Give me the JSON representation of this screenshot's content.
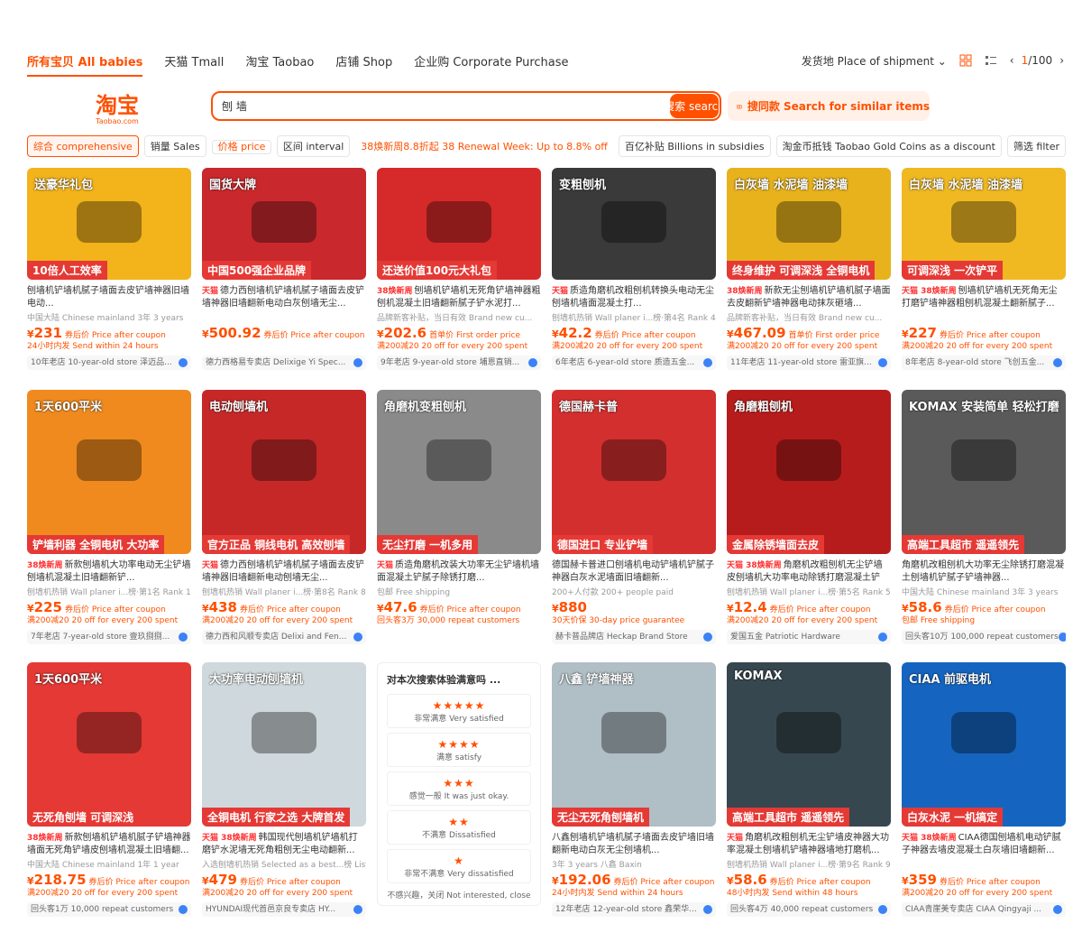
{
  "nav": {
    "tabs": [
      {
        "label": "所有宝贝  All babies",
        "active": true
      },
      {
        "label": "天猫  Tmall"
      },
      {
        "label": "淘宝  Taobao"
      },
      {
        "label": "店铺  Shop"
      },
      {
        "label": "企业购  Corporate Purchase"
      }
    ],
    "ship": "发货地  Place of shipment ⌄",
    "pager_cur": "1",
    "pager_total": "/100",
    "prev": "‹",
    "next": "›"
  },
  "logo": {
    "cn": "淘宝",
    "en": "Taobao.com"
  },
  "search": {
    "value": "刨 墙",
    "button": "搜索  search"
  },
  "similar": {
    "label": "搜同款  Search for similar items"
  },
  "filters": [
    {
      "label": "综合  comprehensive",
      "active": true
    },
    {
      "label": "销量  Sales"
    },
    {
      "label": "价格  price",
      "kind": "price"
    },
    {
      "label": "区间  interval",
      "kind": "interval"
    },
    {
      "label": "38焕新周8.8折起  38 Renewal Week: Up to 8.8% off",
      "kind": "promo"
    },
    {
      "label": "百亿补贴  Billions in subsidies"
    },
    {
      "label": "淘金币抵钱  Taobao Gold Coins as a discount"
    },
    {
      "label": "筛选  filter"
    }
  ],
  "products": [
    {
      "bg": "#f2b31b",
      "text": "送豪华礼包",
      "badge": "10倍人工效率",
      "tag": "",
      "title": "刨墙机铲墙机腻子墙面去皮铲墙神器旧墙电动...",
      "meta": "中国大陆  Chinese mainland  3年  3 years",
      "price": "231",
      "plabel": "券后价  Price after coupon",
      "disc": "24小时内发  Send within 24 hours",
      "store": "10年老店  10-year-old store  泽迈品..."
    },
    {
      "bg": "#c9282d",
      "text": "国货大牌",
      "badge": "中国500强企业品牌",
      "tag": "天猫",
      "title": "德力西刨墙机铲墙机腻子墙面去皮铲墙神器旧墙翻新电动白灰刨墙无尘...",
      "meta": "",
      "price": "500.92",
      "plabel": "券后价  Price after coupon",
      "disc": "",
      "store": "德力西格易专卖店  Delixige Yi Spec..."
    },
    {
      "bg": "#d62a2a",
      "text": "",
      "badge": "还送价值100元大礼包",
      "tag": "38焕新周",
      "title": "刨墙机铲墙机无死角铲墙神器粗刨机混凝土旧墙翻新腻子铲水泥打...",
      "meta": "品牌新客补贴，当日有效  Brand new cu...",
      "price": "202.6",
      "plabel": "首单价  First order price",
      "disc": "满200减20  20 off for every 200 spent",
      "store": "9年老店  9-year-old store  埔恩直销..."
    },
    {
      "bg": "#3a3a3a",
      "text": "变粗刨机",
      "badge": "",
      "tag": "天猫",
      "title": "质造角磨机改粗刨机转换头电动无尘刨墙机墙面混凝土打...",
      "meta": "刨墙机热销  Wall planer i...榜·第4名  Rank 4",
      "price": "42.2",
      "plabel": "券后价  Price after coupon",
      "disc": "满200减20  20 off for every 200 spent",
      "store": "6年老店  6-year-old store  质造五金..."
    },
    {
      "bg": "#e8b21c",
      "text": "白灰墙 水泥墙 油漆墙",
      "badge": "终身维护 可调深浅 全铜电机",
      "tag": "38焕新周",
      "title": "新款无尘刨墙机铲墙机腻子墙面去皮翻新铲墙神器电动抹灰砸墙...",
      "meta": "品牌新客补贴，当日有效  Brand new cu...",
      "price": "467.09",
      "plabel": "首单价  First order price",
      "disc": "满200减20  20 off for every 200 spent",
      "store": "11年老店  11-year-old store  雷亚旗..."
    },
    {
      "bg": "#f0b922",
      "text": "白灰墙 水泥墙 油漆墙",
      "badge": "可调深浅 一次铲平",
      "tag": "天猫 38焕新周",
      "title": "刨墙机铲墙机无死角无尘打磨铲墙神器粗刨机混凝土翻新腻子...",
      "meta": "",
      "price": "227",
      "plabel": "券后价  Price after coupon",
      "disc": "满200减20  20 off for every 200 spent",
      "store": "8年老店  8-year-old store  飞创五金..."
    },
    {
      "bg": "#f08a1e",
      "text": "1天600平米",
      "badge": "铲墙利器 全铜电机 大功率",
      "tag": "38焕新周",
      "title": "新款刨墙机大功率电动无尘铲墙刨墙机混凝土旧墙翻新铲...",
      "meta": "刨墙机热销  Wall planer i...榜·第1名  Rank 1",
      "price": "225",
      "plabel": "券后价  Price after coupon",
      "disc": "满200减20  20 off for every 200 spent",
      "store": "7年老店  7-year-old store  壹玖捌捌..."
    },
    {
      "bg": "#c62828",
      "text": "电动刨墙机",
      "badge": "官方正品 铜线电机 高效刨墙",
      "tag": "天猫",
      "title": "德力西刨墙机铲墙机腻子墙面去皮铲墙神器旧墙翻新电动刨墙无尘...",
      "meta": "刨墙机热销  Wall planer i...榜·第8名  Rank 8",
      "price": "438",
      "plabel": "券后价  Price after coupon",
      "disc": "满200减20  20 off for every 200 spent",
      "store": "德力西和风顺专卖店  Delixi and Fen..."
    },
    {
      "bg": "#8a8a8a",
      "text": "角磨机变粗刨机",
      "badge": "无尘打磨 一机多用",
      "tag": "天猫",
      "title": "质造角磨机改装大功率无尘铲墙机墙面混凝土铲腻子除锈打磨...",
      "meta": "包邮  Free shipping",
      "price": "47.6",
      "plabel": "券后价  Price after coupon",
      "disc": "回头客3万  30,000 repeat customers",
      "store": ""
    },
    {
      "bg": "#d32f2f",
      "text": "德国赫卡普",
      "badge": "德国进口 专业铲墙",
      "tag": "",
      "title": "德国赫卡普进口刨墙机电动铲墙机铲腻子神器白灰水泥墙面旧墙翻新...",
      "meta": "200+人付款  200+ people paid",
      "price": "880",
      "plabel": "",
      "disc": "30天价保  30-day price guarantee",
      "store": "赫卡普品牌店  Heckap Brand Store"
    },
    {
      "bg": "#b71c1c",
      "text": "角磨粗刨机",
      "badge": "金属除锈墙面去皮",
      "tag": "天猫 38焕新周",
      "title": "角磨机改粗刨机无尘铲墙皮刨墙机大功率电动除锈打磨混凝土铲腻...",
      "meta": "刨墙机热销  Wall planer i...榜·第5名  Rank 5",
      "price": "12.4",
      "plabel": "券后价  Price after coupon",
      "disc": "满200减20  20 off for every 200 spent",
      "store": "爱国五金  Patriotic Hardware"
    },
    {
      "bg": "#5a5a5a",
      "text": "KOMAX 安装简单 轻松打磨",
      "badge": "高端工具超市 遥遥领先",
      "tag": "",
      "title": "角磨机改粗刨机大功率无尘除锈打磨混凝土刨墙机铲腻子铲墙神器...",
      "meta": "中国大陆  Chinese mainland  3年  3 years",
      "price": "58.6",
      "plabel": "券后价  Price after coupon",
      "disc": "包邮  Free shipping",
      "store": "回头客10万  100,000 repeat customers"
    },
    {
      "bg": "#e53935",
      "text": "1天600平米",
      "badge": "无死角刨墙 可调深浅",
      "tag": "38焕新周",
      "title": "新款刨墙机铲墙机腻子铲墙神器墙面无死角铲墙皮刨墙机混凝土旧墙翻...",
      "meta": "中国大陆  Chinese mainland  1年  1 year",
      "price": "218.75",
      "plabel": "券后价  Price after coupon",
      "disc": "满200减20  20 off for every 200 spent",
      "store": "回头客1万  10,000 repeat customers"
    },
    {
      "bg": "#cfd8dc",
      "text": "大功率电动刨墙机",
      "badge": "全铜电机 行家之选 大牌首发",
      "tag": "天猫 38焕新周",
      "title": "韩国现代刨墙机铲墙机打磨铲水泥墙无死角粗刨无尘电动翻新...",
      "meta": "入选刨墙机热销  Selected as a best...榜  List",
      "price": "479",
      "plabel": "券后价  Price after coupon",
      "disc": "满200减20  20 off for every 200 spent",
      "store": "HYUNDAI现代首邑京良专卖店  HY..."
    },
    {
      "survey": true
    },
    {
      "bg": "#b0bec5",
      "text": "八鑫 铲墙神器",
      "badge": "无尘无死角刨墙机",
      "tag": "",
      "title": "八鑫刨墙机铲墙机腻子墙面去皮铲墙旧墙翻新电动白灰无尘刨墙机...",
      "meta": "3年  3 years  八鑫  Baxin",
      "price": "192.06",
      "plabel": "券后价  Price after coupon",
      "disc": "24小时内发  Send within 24 hours",
      "store": "12年老店  12-year-old store  鑫荣华..."
    },
    {
      "bg": "#37474f",
      "text": "KOMAX",
      "badge": "高端工具超市 遥遥领先",
      "tag": "天猫",
      "title": "角磨机改粗刨机无尘铲墙皮神器大功率混凝土刨墙机铲墙神器墙地打磨机...",
      "meta": "刨墙机热销  Wall planer i...榜·第9名  Rank 9",
      "price": "58.6",
      "plabel": "券后价  Price after coupon",
      "disc": "48小时内发  Send within 48 hours",
      "store": "回头客4万  40,000 repeat customers"
    },
    {
      "bg": "#1565c0",
      "text": "CIAA 前驱电机",
      "badge": "白灰水泥 一机搞定",
      "tag": "天猫 38焕新周",
      "title": "CIAA德国刨墙机电动铲腻子神器去墙皮混凝土白灰墙旧墙翻新...",
      "meta": "",
      "price": "359",
      "plabel": "券后价  Price after coupon",
      "disc": "满200减20  20 off for every 200 spent",
      "store": "CIAA青崖美专卖店  CIAA Qingyaji ..."
    }
  ],
  "survey": {
    "title": "对本次搜索体验满意吗 ...",
    "options": [
      {
        "stars": "★★★★★",
        "label": "非常满意  Very satisfied"
      },
      {
        "stars": "★★★★",
        "label": "满意  satisfy"
      },
      {
        "stars": "★★★",
        "label": "感觉一般  It was just okay."
      },
      {
        "stars": "★★",
        "label": "不满意  Dissatisfied"
      },
      {
        "stars": "★",
        "label": "非常不满意  Very dissatisfied"
      }
    ],
    "close": "不感兴趣，关闭  Not interested, close"
  },
  "colors": {
    "accent": "#ff5000"
  }
}
